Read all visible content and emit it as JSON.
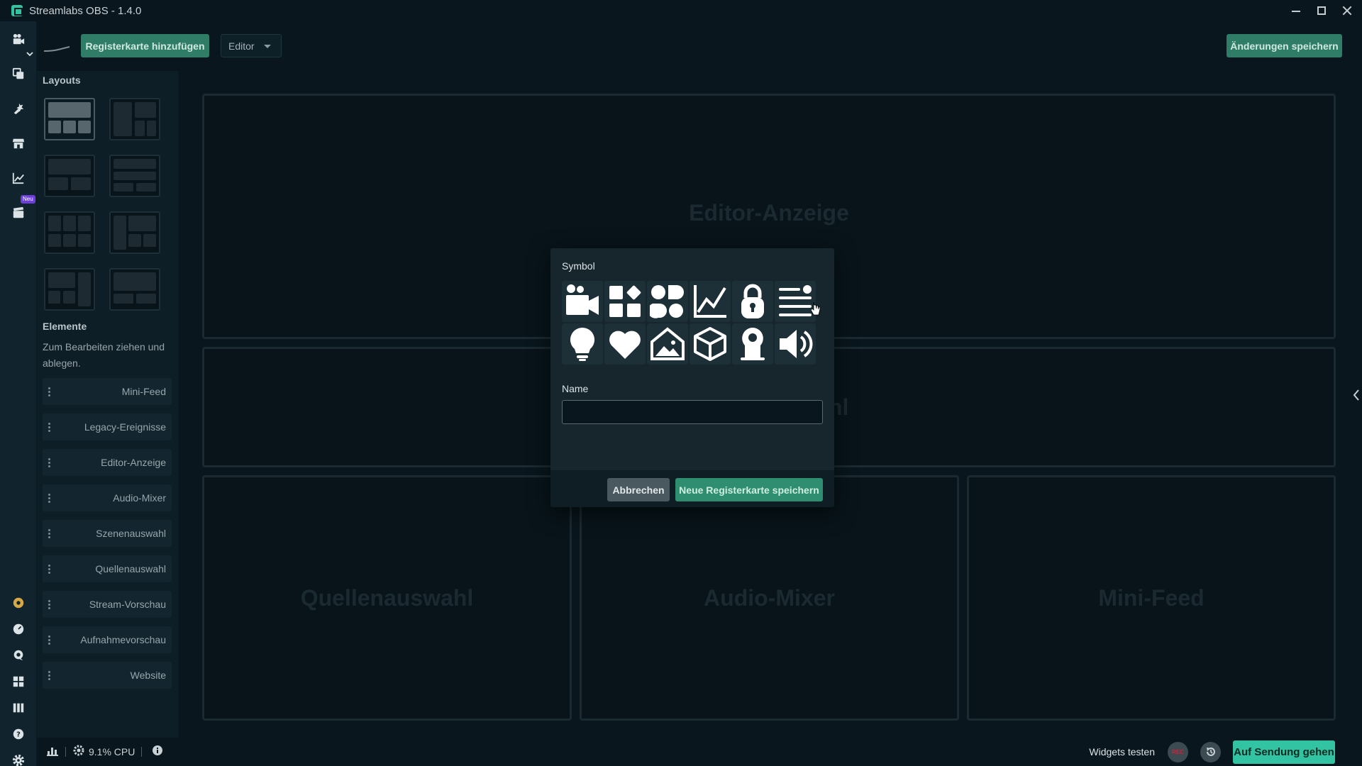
{
  "window": {
    "title": "Streamlabs OBS - 1.4.0",
    "accent_color": "#31c3a2"
  },
  "rail": {
    "badge": "Neu",
    "icons": [
      "studio-icon",
      "themes-icon",
      "apps-icon",
      "store-icon",
      "analytics-icon",
      "highlighter-icon",
      "prime-icon",
      "dashboard-icon",
      "help-chat-icon",
      "layout-icon",
      "library-icon",
      "help-icon",
      "settings-icon"
    ]
  },
  "toolbar": {
    "add_tab_label": "Registerkarte hinzufügen",
    "editor_select_value": "Editor",
    "save_changes_label": "Änderungen speichern"
  },
  "panel": {
    "layouts_heading": "Layouts",
    "elements_heading": "Elemente",
    "elements_hint": "Zum Bearbeiten ziehen und ablegen.",
    "elements": [
      "Mini-Feed",
      "Legacy-Ereignisse",
      "Editor-Anzeige",
      "Audio-Mixer",
      "Szenenauswahl",
      "Quellenauswahl",
      "Stream-Vorschau",
      "Aufnahmevorschau",
      "Website"
    ]
  },
  "editor": {
    "slot_1": "Editor-Anzeige",
    "slot_2_partial": "hl",
    "slot_3": "Quellenauswahl",
    "slot_4": "Audio-Mixer",
    "slot_5": "Mini-Feed"
  },
  "modal": {
    "symbol_label": "Symbol",
    "name_label": "Name",
    "name_value": "",
    "cancel_label": "Abbrechen",
    "save_label": "Neue Registerkarte speichern",
    "symbols": [
      "studio-icon",
      "widgets-icon",
      "blocks-icon",
      "chart-icon",
      "lock-icon",
      "list-icon",
      "lightbulb-icon",
      "heart-icon",
      "image-icon",
      "cube-icon",
      "pin-icon",
      "speaker-icon"
    ]
  },
  "footer": {
    "cpu": "9.1% CPU",
    "widgets_test_label": "Widgets testen",
    "rec_label": "REC",
    "go_live_label": "Auf Sendung gehen"
  }
}
